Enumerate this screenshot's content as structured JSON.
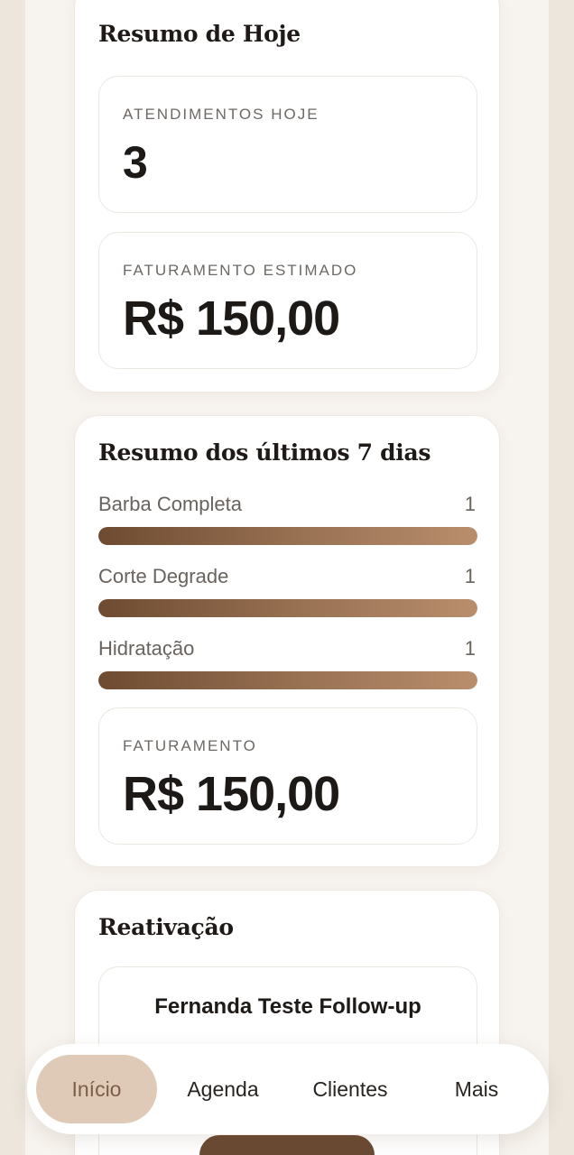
{
  "today": {
    "title": "Resumo de Hoje",
    "appointments_label": "ATENDIMENTOS HOJE",
    "appointments_value": "3",
    "revenue_label": "FATURAMENTO ESTIMADO",
    "revenue_value": "R$ 150,00"
  },
  "week": {
    "title": "Resumo dos últimos 7 dias",
    "services": [
      {
        "name": "Barba Completa",
        "count": "1",
        "fill": 1.0
      },
      {
        "name": "Corte Degrade",
        "count": "1",
        "fill": 1.0
      },
      {
        "name": "Hidratação",
        "count": "1",
        "fill": 1.0
      }
    ],
    "revenue_label": "FATURAMENTO",
    "revenue_value": "R$ 150,00"
  },
  "reactivation": {
    "title": "Reativação",
    "client_name": "Fernanda Teste Follow-up"
  },
  "nav": {
    "items": [
      {
        "label": "Início",
        "active": true
      },
      {
        "label": "Agenda",
        "active": false
      },
      {
        "label": "Clientes",
        "active": false
      },
      {
        "label": "Mais",
        "active": false
      }
    ]
  },
  "colors": {
    "accent": "#6b4a33",
    "active_nav": "#dfcab8",
    "bar_start": "#6e4b31",
    "bar_end": "#b88e6c"
  }
}
